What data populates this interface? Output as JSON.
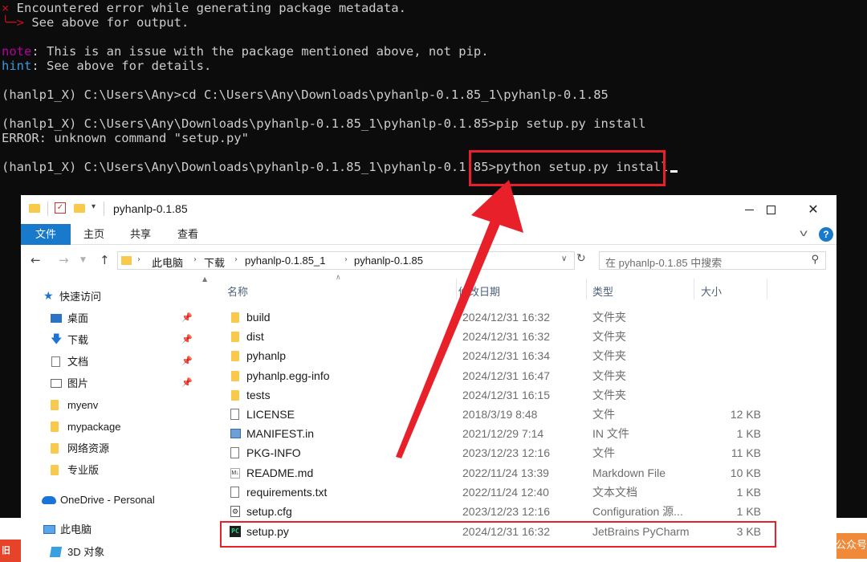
{
  "terminal": {
    "lines": {
      "err_x": "×",
      "err_msg": " Encountered error while generating package metadata.",
      "see_arrow": "╰─>",
      "see_msg": " See above for output.",
      "note_label": "note",
      "note_msg": ": This is an issue with the package mentioned above, not pip.",
      "hint_label": "hint",
      "hint_msg": ": See above for details.",
      "cd_cmd": "(hanlp1_X) C:\\Users\\Any>cd C:\\Users\\Any\\Downloads\\pyhanlp-0.1.85_1\\pyhanlp-0.1.85",
      "pip_cmd": "(hanlp1_X) C:\\Users\\Any\\Downloads\\pyhanlp-0.1.85_1\\pyhanlp-0.1.85>pip setup.py install",
      "pip_error": "ERROR: unknown command \"setup.py\"",
      "prompt": "(hanlp1_X) C:\\Users\\Any\\Downloads\\pyhanlp-0.1.85_1\\pyhanlp-0.1.85>",
      "python_cmd": "python setup.py install"
    }
  },
  "explorer": {
    "title": "pyhanlp-0.1.85",
    "ribbon_tabs": [
      "文件",
      "主页",
      "共享",
      "查看"
    ],
    "breadcrumbs": [
      "此电脑",
      "下载",
      "pyhanlp-0.1.85_1",
      "pyhanlp-0.1.85"
    ],
    "search_placeholder": "在 pyhanlp-0.1.85 中搜索",
    "columns": {
      "name": "名称",
      "date": "修改日期",
      "type": "类型",
      "size": "大小"
    },
    "nav_items": [
      {
        "label": "快速访问",
        "icon": "star-icon"
      },
      {
        "label": "桌面",
        "icon": "desktop-icon",
        "pinned": true
      },
      {
        "label": "下载",
        "icon": "download-icon",
        "pinned": true
      },
      {
        "label": "文档",
        "icon": "document-icon",
        "pinned": true
      },
      {
        "label": "图片",
        "icon": "picture-icon",
        "pinned": true
      },
      {
        "label": "myenv",
        "icon": "folder-icon"
      },
      {
        "label": "mypackage",
        "icon": "folder-icon"
      },
      {
        "label": "网络资源",
        "icon": "folder-icon"
      },
      {
        "label": "专业版",
        "icon": "folder-icon"
      },
      {
        "label": "OneDrive - Personal",
        "icon": "cloud-icon"
      },
      {
        "label": "此电脑",
        "icon": "pc-icon"
      },
      {
        "label": "3D 对象",
        "icon": "cube-icon"
      }
    ],
    "files": [
      {
        "name": "build",
        "date": "2024/12/31 16:32",
        "type": "文件夹",
        "size": "",
        "icon": "folder"
      },
      {
        "name": "dist",
        "date": "2024/12/31 16:32",
        "type": "文件夹",
        "size": "",
        "icon": "folder"
      },
      {
        "name": "pyhanlp",
        "date": "2024/12/31 16:34",
        "type": "文件夹",
        "size": "",
        "icon": "folder"
      },
      {
        "name": "pyhanlp.egg-info",
        "date": "2024/12/31 16:47",
        "type": "文件夹",
        "size": "",
        "icon": "folder"
      },
      {
        "name": "tests",
        "date": "2024/12/31 16:15",
        "type": "文件夹",
        "size": "",
        "icon": "folder"
      },
      {
        "name": "LICENSE",
        "date": "2018/3/19 8:48",
        "type": "文件",
        "size": "12 KB",
        "icon": "doc"
      },
      {
        "name": "MANIFEST.in",
        "date": "2021/12/29 7:14",
        "type": "IN 文件",
        "size": "1 KB",
        "icon": "manifest"
      },
      {
        "name": "PKG-INFO",
        "date": "2023/12/23 12:16",
        "type": "文件",
        "size": "11 KB",
        "icon": "doc"
      },
      {
        "name": "README.md",
        "date": "2022/11/24 13:39",
        "type": "Markdown File",
        "size": "10 KB",
        "icon": "md"
      },
      {
        "name": "requirements.txt",
        "date": "2022/11/24 12:40",
        "type": "文本文档",
        "size": "1 KB",
        "icon": "doc"
      },
      {
        "name": "setup.cfg",
        "date": "2023/12/23 12:16",
        "type": "Configuration 源...",
        "size": "1 KB",
        "icon": "cfg"
      },
      {
        "name": "setup.py",
        "date": "2024/12/31 16:32",
        "type": "JetBrains PyCharm",
        "size": "3 KB",
        "icon": "pycharm"
      }
    ]
  },
  "overlay": {
    "right_badge": "公众号",
    "left_badge": "旧"
  },
  "colors": {
    "accent": "#1979ca",
    "highlight": "#e8202a",
    "folder": "#f8c94b",
    "terminal_bg": "#0c0c0c"
  }
}
